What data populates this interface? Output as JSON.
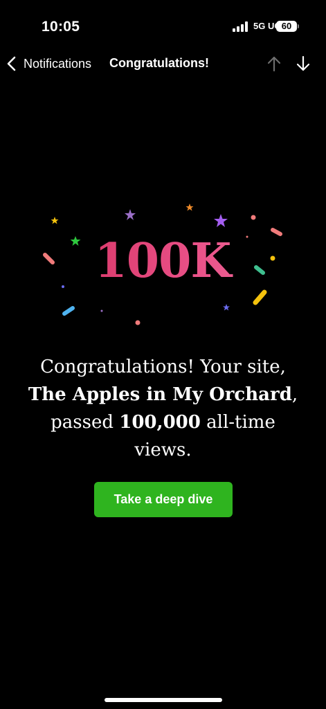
{
  "status_bar": {
    "time": "10:05",
    "network": "5G UC",
    "battery": "60"
  },
  "nav": {
    "back_label": "Notifications",
    "title": "Congratulations!"
  },
  "badge": {
    "value": "100K",
    "gradient_colors": [
      "#d4305f",
      "#f06e9e"
    ]
  },
  "message": {
    "part1": "Congratulations! Your site, ",
    "site_name": "The Apples in My Orchard",
    "part2": ", passed ",
    "count": "100,000",
    "part3": " all-time views."
  },
  "cta": {
    "label": "Take a deep dive",
    "color": "#2fb41f"
  }
}
